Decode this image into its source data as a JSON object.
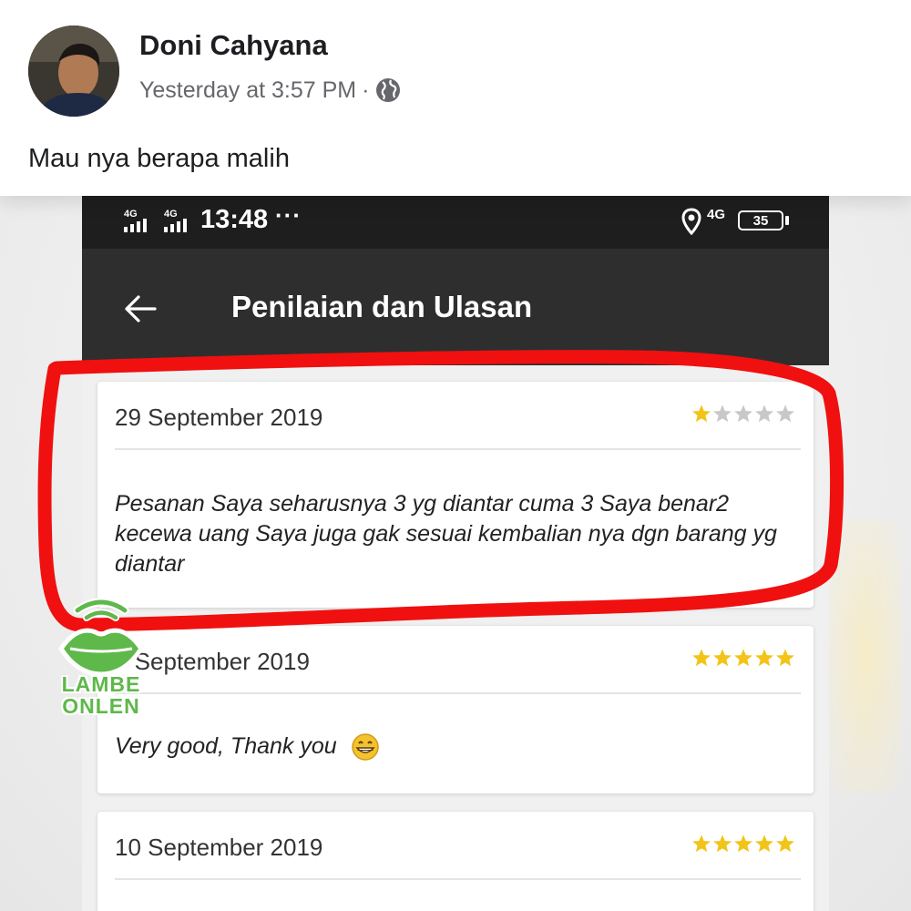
{
  "post": {
    "author": "Doni Cahyana",
    "timestamp": "Yesterday at 3:57 PM",
    "separator": "·",
    "audience_icon": "globe-icon",
    "caption": "Mau nya berapa malih"
  },
  "phone": {
    "status_bar": {
      "signal_labels": [
        "4G",
        "4G"
      ],
      "time": "13:48",
      "more": "···",
      "network": "4G",
      "battery": "35"
    },
    "app_bar": {
      "back_icon": "arrow-left-icon",
      "title": "Penilaian dan Ulasan"
    },
    "reviews": [
      {
        "date": "29 September 2019",
        "rating": 1,
        "max_rating": 5,
        "text": "Pesanan Saya seharusnya 3 yg diantar cuma 3 Saya benar2 kecewa uang Saya juga gak sesuai kembalian nya dgn barang yg diantar"
      },
      {
        "date": "3 September 2019",
        "date_visible": "3 September 2019",
        "rating": 5,
        "max_rating": 5,
        "text": "Very good, Thank you",
        "emoji": "grinning-face-icon"
      },
      {
        "date": "10 September 2019",
        "rating": 5,
        "max_rating": 5,
        "text": ""
      }
    ]
  },
  "colors": {
    "star_filled": "#f2c417",
    "star_empty": "#c8c8c8",
    "annotation": "#f01010",
    "watermark": "#5fb84a"
  },
  "watermark": {
    "line1": "LAMBE",
    "line2": "ONLEN"
  }
}
